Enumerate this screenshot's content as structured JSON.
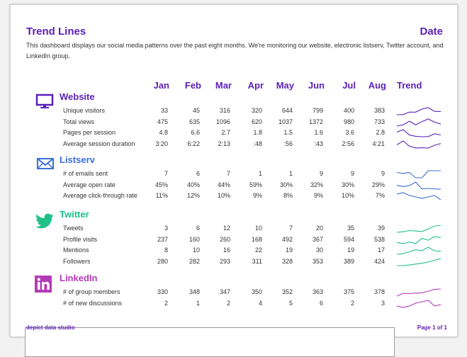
{
  "title": "Trend Lines",
  "date_label": "Date",
  "description": "This dashboard displays our social media patterns over the past eight months. We're monitoring our website, electronic listserv, Twitter account, and LinkedIn group.",
  "columns": [
    "Jan",
    "Feb",
    "Mar",
    "Apr",
    "May",
    "Jun",
    "Jul",
    "Aug"
  ],
  "trend_label": "Trend",
  "colors": {
    "brand": "#5b1fb8",
    "website": "#5b1fb8",
    "listserv": "#3a6fd8",
    "twitter": "#1fbf88",
    "linkedin": "#b53ab8"
  },
  "sections": [
    {
      "name": "Website",
      "icon": "monitor-icon",
      "rows": [
        {
          "label": "Unique visitors",
          "values": [
            "33",
            "45",
            "316",
            "320",
            "644",
            "799",
            "400",
            "383"
          ],
          "spark": [
            33,
            45,
            316,
            320,
            644,
            799,
            400,
            383
          ]
        },
        {
          "label": "Total views",
          "values": [
            "475",
            "635",
            "1096",
            "620",
            "1037",
            "1372",
            "980",
            "733"
          ],
          "spark": [
            475,
            635,
            1096,
            620,
            1037,
            1372,
            980,
            733
          ]
        },
        {
          "label": "Pages per session",
          "values": [
            "4.8",
            "6.6",
            "2.7",
            "1.8",
            "1.5",
            "1.6",
            "3.6",
            "2.8"
          ],
          "spark": [
            4.8,
            6.6,
            2.7,
            1.8,
            1.5,
            1.6,
            3.6,
            2.8
          ]
        },
        {
          "label": "Average session duration",
          "values": [
            "3:20",
            "6:22",
            "2:13",
            ":48",
            ":56",
            ":43",
            "2:56",
            "4:21"
          ],
          "spark": [
            200,
            382,
            133,
            48,
            56,
            43,
            176,
            261
          ]
        }
      ]
    },
    {
      "name": "Listserv",
      "icon": "envelope-icon",
      "rows": [
        {
          "label": "# of emails sent",
          "values": [
            "7",
            "6",
            "7",
            "1",
            "1",
            "9",
            "9",
            "9"
          ],
          "spark": [
            7,
            6,
            7,
            1,
            1,
            9,
            9,
            9
          ]
        },
        {
          "label": "Average open rate",
          "values": [
            "45%",
            "40%",
            "44%",
            "59%",
            "30%",
            "32%",
            "30%",
            "29%"
          ],
          "spark": [
            45,
            40,
            44,
            59,
            30,
            32,
            30,
            29
          ]
        },
        {
          "label": "Average click-through rate",
          "values": [
            "11%",
            "12%",
            "10%",
            "9%",
            "8%",
            "9%",
            "10%",
            "7%"
          ],
          "spark": [
            11,
            12,
            10,
            9,
            8,
            9,
            10,
            7
          ]
        }
      ]
    },
    {
      "name": "Twitter",
      "icon": "bird-icon",
      "rows": [
        {
          "label": "Tweets",
          "values": [
            "3",
            "6",
            "12",
            "10",
            "7",
            "20",
            "35",
            "39"
          ],
          "spark": [
            3,
            6,
            12,
            10,
            7,
            20,
            35,
            39
          ]
        },
        {
          "label": "Profile visits",
          "values": [
            "237",
            "160",
            "260",
            "168",
            "492",
            "367",
            "594",
            "538"
          ],
          "spark": [
            237,
            160,
            260,
            168,
            492,
            367,
            594,
            538
          ]
        },
        {
          "label": "Mentions",
          "values": [
            "8",
            "10",
            "16",
            "22",
            "19",
            "30",
            "19",
            "17"
          ],
          "spark": [
            8,
            10,
            16,
            22,
            19,
            30,
            19,
            17
          ]
        },
        {
          "label": "Followers",
          "values": [
            "280",
            "282",
            "293",
            "311",
            "328",
            "353",
            "389",
            "424"
          ],
          "spark": [
            280,
            282,
            293,
            311,
            328,
            353,
            389,
            424
          ]
        }
      ]
    },
    {
      "name": "LinkedIn",
      "icon": "linkedin-icon",
      "rows": [
        {
          "label": "# of group members",
          "values": [
            "330",
            "348",
            "347",
            "350",
            "352",
            "363",
            "375",
            "378"
          ],
          "spark": [
            330,
            348,
            347,
            350,
            352,
            363,
            375,
            378
          ]
        },
        {
          "label": "# of new discussions",
          "values": [
            "2",
            "1",
            "2",
            "4",
            "5",
            "6",
            "2",
            "3"
          ],
          "spark": [
            2,
            1,
            2,
            4,
            5,
            6,
            2,
            3
          ]
        }
      ]
    }
  ],
  "footer": {
    "left": "depict data studio",
    "right": "Page 1 of 1"
  }
}
